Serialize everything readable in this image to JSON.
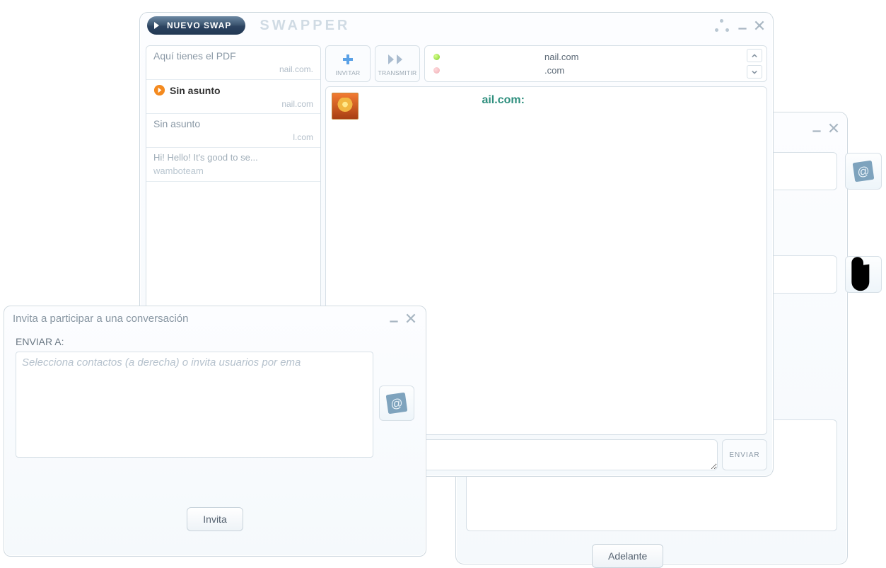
{
  "main": {
    "nuevo_swap": "NUEVO SWAP",
    "app_title": "SWAPPER",
    "toolbar": {
      "invitar": "INVITAR",
      "transmitir": "TRANSMITIR"
    },
    "contacts": [
      {
        "status": "online",
        "email": "nail.com"
      },
      {
        "status": "offline",
        "email": ".com"
      }
    ],
    "chat_header_email": "ail.com:",
    "send_label": "ENVIAR",
    "sidebar": [
      {
        "subject": "Aquí tienes el PDF",
        "from": "nail.com."
      },
      {
        "subject": "Sin asunto",
        "from": "nail.com"
      },
      {
        "subject": "Sin asunto",
        "from": "l.com"
      },
      {
        "subject": " Hi!    Hello! It's good to se...",
        "author": "wamboteam"
      }
    ]
  },
  "bg": {
    "adelante": "Adelante"
  },
  "invite": {
    "title": "Invita a participar a una conversación",
    "enviar_a": "ENVIAR A:",
    "placeholder": "Selecciona contactos (a derecha) o invita usuarios por ema",
    "invita_btn": "Invita"
  }
}
